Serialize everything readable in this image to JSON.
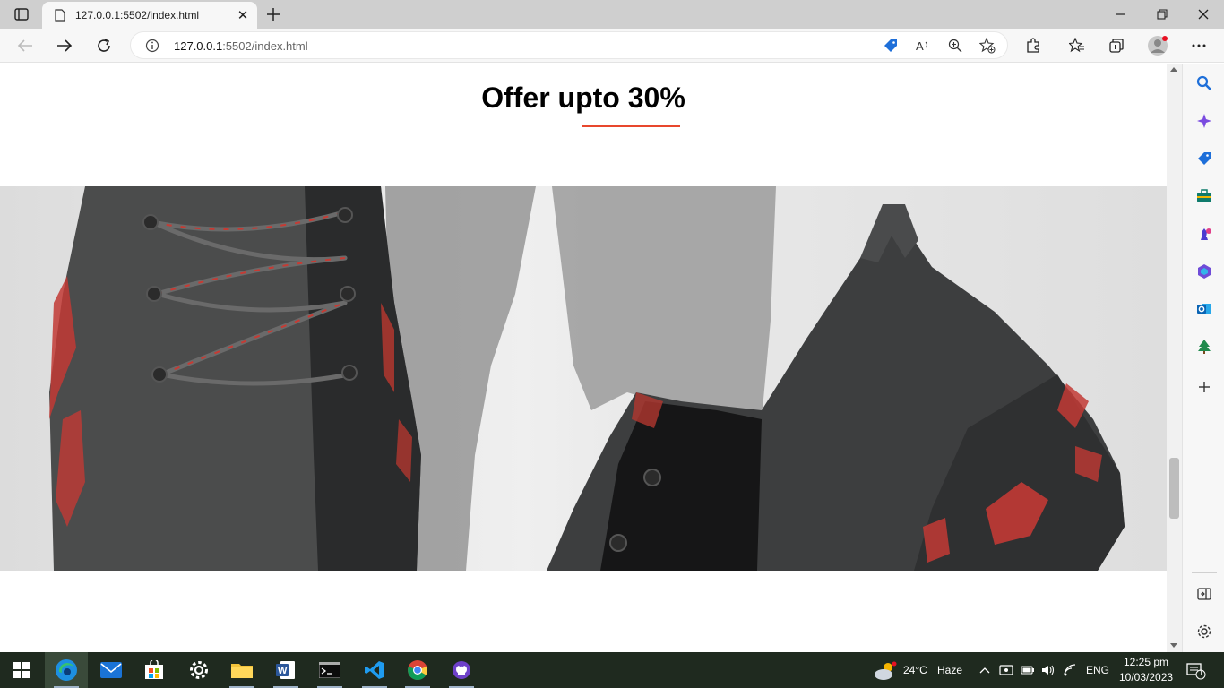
{
  "browser": {
    "tab": {
      "title": "127.0.0.1:5502/index.html",
      "close_label": "✕"
    },
    "new_tab_label": "+",
    "address": {
      "host": "127.0.0.1",
      "path": ":5502/index.html"
    }
  },
  "page": {
    "heading": "Offer upto 30%"
  },
  "colors": {
    "accent_underline": "#e8472d",
    "taskbar_bg": "#1f2a1f"
  },
  "taskbar": {
    "pinned": [
      "edge-icon",
      "mail-icon",
      "store-icon",
      "settings-icon",
      "file-explorer-icon",
      "word-icon",
      "terminal-icon",
      "vscode-icon",
      "chrome-icon",
      "github-desktop-icon"
    ],
    "weather": {
      "temp": "24°C",
      "condition": "Haze"
    },
    "language": "ENG",
    "time": "12:25 pm",
    "date": "10/03/2023",
    "notification_count": "1"
  }
}
